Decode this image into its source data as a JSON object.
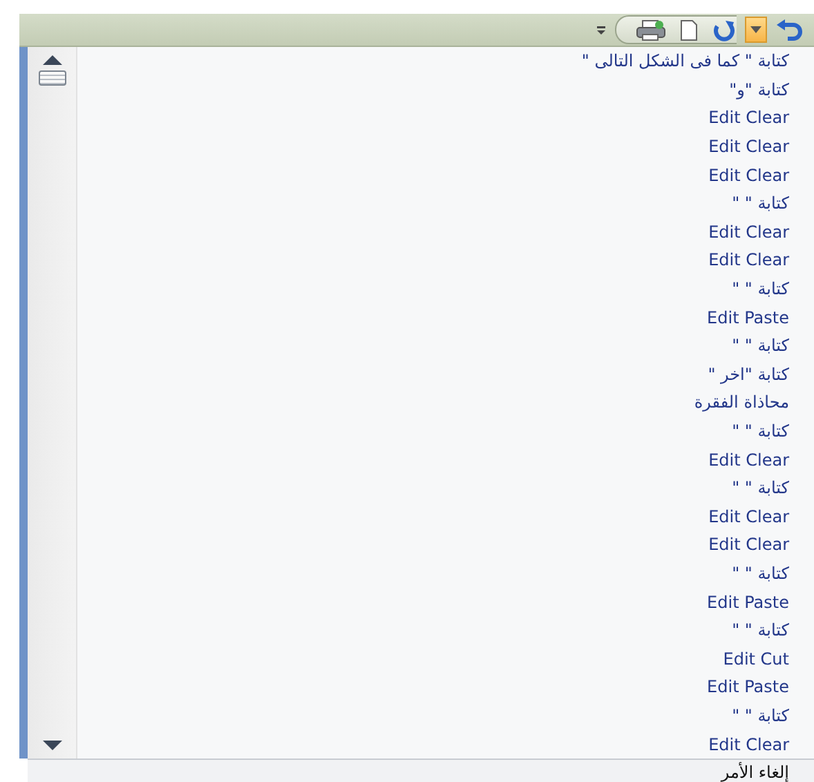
{
  "undo_list": {
    "items": [
      {
        "text": "كتابة \" كما فى الشكل التالى \""
      },
      {
        "text": "كتابة \"و\""
      },
      {
        "text": "Edit Clear"
      },
      {
        "text": "Edit Clear"
      },
      {
        "text": "Edit Clear"
      },
      {
        "text": "كتابة \" \""
      },
      {
        "text": "Edit Clear"
      },
      {
        "text": "Edit Clear"
      },
      {
        "text": "كتابة \" \""
      },
      {
        "text": "Edit Paste"
      },
      {
        "text": "كتابة \" \""
      },
      {
        "text": "كتابة \"اخر \""
      },
      {
        "text": "محاذاة الفقرة"
      },
      {
        "text": "كتابة \" \""
      },
      {
        "text": "Edit Clear"
      },
      {
        "text": "كتابة \" \""
      },
      {
        "text": "Edit Clear"
      },
      {
        "text": "Edit Clear"
      },
      {
        "text": "كتابة \" \""
      },
      {
        "text": "Edit Paste"
      },
      {
        "text": "كتابة \" \""
      },
      {
        "text": "Edit Cut"
      },
      {
        "text": "Edit Paste"
      },
      {
        "text": "كتابة \" \""
      },
      {
        "text": "Edit Clear"
      }
    ]
  },
  "status": {
    "text": "إلغاء الأمر"
  }
}
